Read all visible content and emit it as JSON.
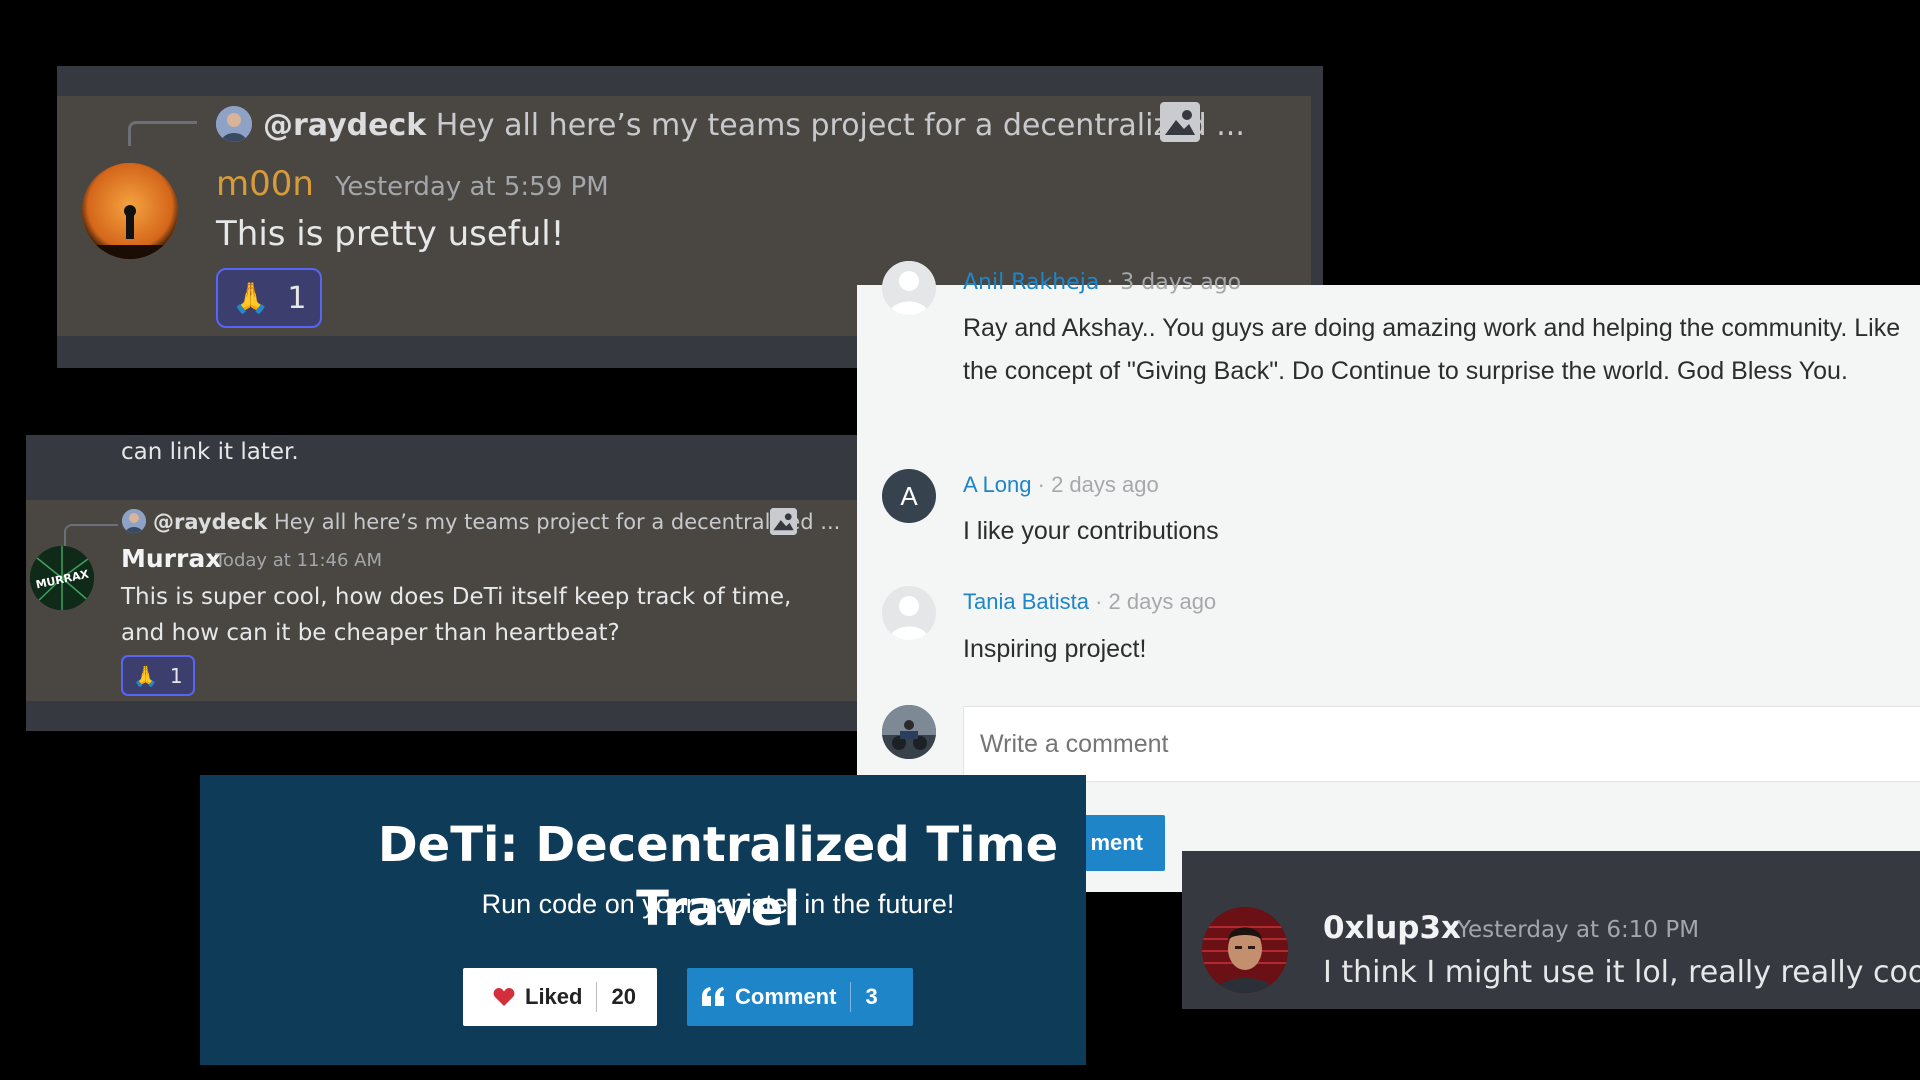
{
  "discord_top": {
    "reply": {
      "mention": "@raydeck",
      "preview": "Hey all here’s my teams project for a decentralized ..."
    },
    "username": "m00n",
    "username_color": "#d89b3a",
    "timestamp": "Yesterday at 5:59 PM",
    "message": "This is pretty useful!",
    "reaction": {
      "emoji": "🙏",
      "count": "1"
    }
  },
  "discord_middle": {
    "previous_message_tail": "can link it later.",
    "reply": {
      "mention": "@raydeck",
      "preview": "Hey all here’s my teams project for a decentralized ..."
    },
    "username": "Murrax",
    "avatar_text": "MURRAX",
    "timestamp": "Today at 11:46 AM",
    "message": "This is super cool, how does DeTi itself keep track of time, and how can it be cheaper than heartbeat?",
    "reaction": {
      "emoji": "🙏",
      "count": "1"
    }
  },
  "devpost_comments": {
    "partial_header": {
      "name": "Anil Rakheja",
      "time": "· 3 days ago"
    },
    "comments": [
      {
        "text": "Ray and Akshay.. You guys are doing amazing work and helping the community. Like the concept of \"Giving Back\". Do Continue to surprise the world. God Bless You."
      },
      {
        "avatar_letter": "A",
        "name": "A Long",
        "time": "· 2 days ago",
        "text": "I like your contributions"
      },
      {
        "name": "Tania Batista",
        "time": "· 2 days ago",
        "text": "Inspiring project!"
      }
    ],
    "input_placeholder": "Write a comment",
    "submit_label": "ment",
    "accent": "#1e85c9"
  },
  "project_banner": {
    "title": "DeTi: Decentralized Time Travel",
    "subtitle": "Run code on your canister in the future!",
    "like_button": {
      "label": "Liked",
      "count": "20"
    },
    "comment_button": {
      "label": "Comment",
      "count": "3"
    },
    "background": "#0e3b57",
    "like_icon": "heart-icon",
    "comment_icon": "quote-icon"
  },
  "discord_bottom": {
    "username": "0xlup3x",
    "timestamp": "Yesterday at 6:10 PM",
    "message": "I think I might use it lol, really really cool"
  }
}
